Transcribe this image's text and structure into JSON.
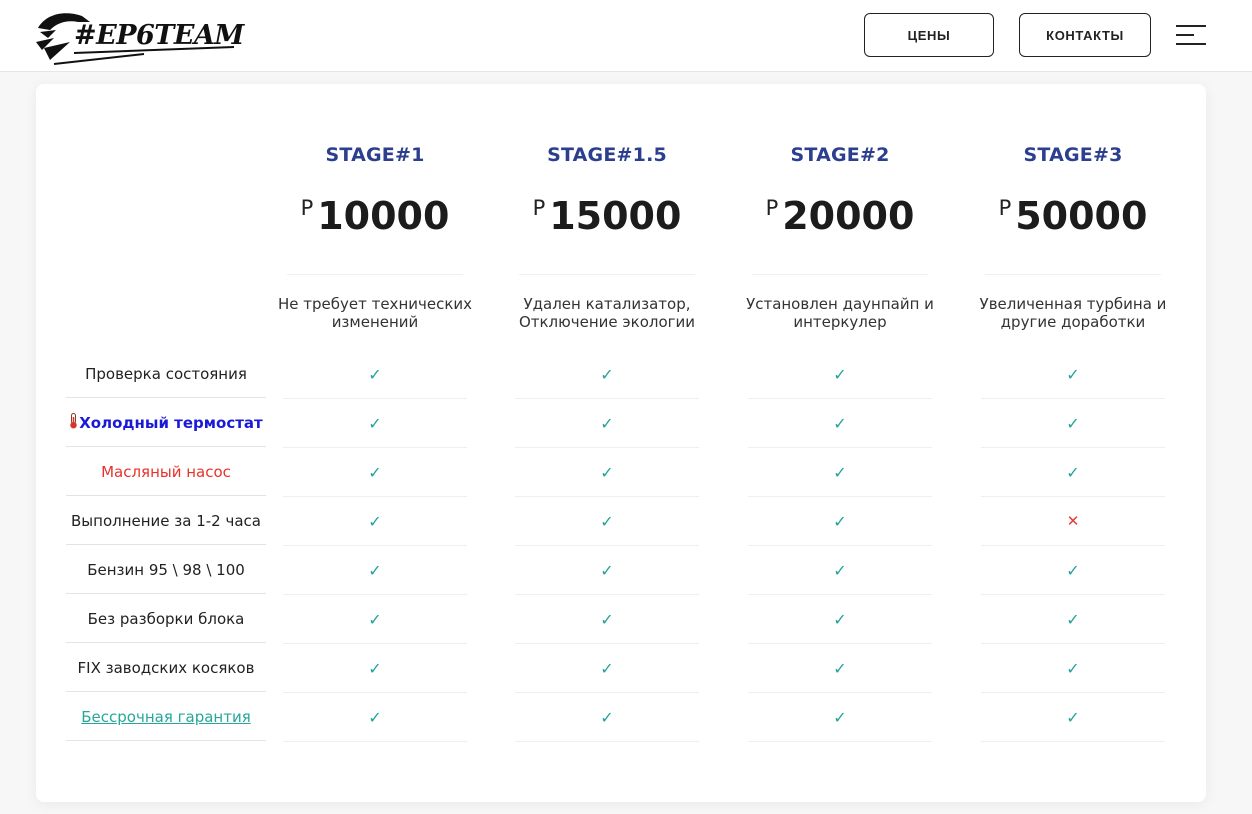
{
  "header": {
    "logo_text": "#EP6TEAM",
    "prices_label": "ЦЕНЫ",
    "contacts_label": "КОНТАКТЫ"
  },
  "plans": [
    {
      "title": "STAGE#1",
      "currency": "Р",
      "price": "10000",
      "description": "Не требует технических изменений"
    },
    {
      "title": "STAGE#1.5",
      "currency": "Р",
      "price": "15000",
      "description": "Удален катализатор, Отключение экологии"
    },
    {
      "title": "STAGE#2",
      "currency": "Р",
      "price": "20000",
      "description": "Установлен даунпайп и интеркулер"
    },
    {
      "title": "STAGE#3",
      "currency": "Р",
      "price": "50000",
      "description": "Увеличенная турбина и другие доработки"
    }
  ],
  "features": [
    {
      "label": "Проверка состояния",
      "values": [
        true,
        true,
        true,
        true
      ]
    },
    {
      "label": "Холодный термостат",
      "icon": "thermometer-icon",
      "values": [
        true,
        true,
        true,
        true
      ]
    },
    {
      "label": "Масляный насос",
      "values": [
        true,
        true,
        true,
        true
      ]
    },
    {
      "label": "Выполнение за 1-2 часа",
      "values": [
        true,
        true,
        true,
        false
      ]
    },
    {
      "label": "Бензин 95 \\ 98 \\ 100",
      "values": [
        true,
        true,
        true,
        true
      ]
    },
    {
      "label": "Без разборки блока",
      "values": [
        true,
        true,
        true,
        true
      ]
    },
    {
      "label": "FIX заводских косяков",
      "values": [
        true,
        true,
        true,
        true
      ]
    },
    {
      "label": "Бессрочная гарантия",
      "values": [
        true,
        true,
        true,
        true
      ]
    }
  ],
  "marks": {
    "yes": "✓",
    "no": "✕"
  },
  "colors": {
    "stage_title": "#2b3f8e",
    "check": "#23a39a",
    "cross": "#e23b3b",
    "thermostat_label": "#1a1ad6",
    "oil_pump_label": "#e8322a",
    "warranty_link": "#25a89a"
  }
}
